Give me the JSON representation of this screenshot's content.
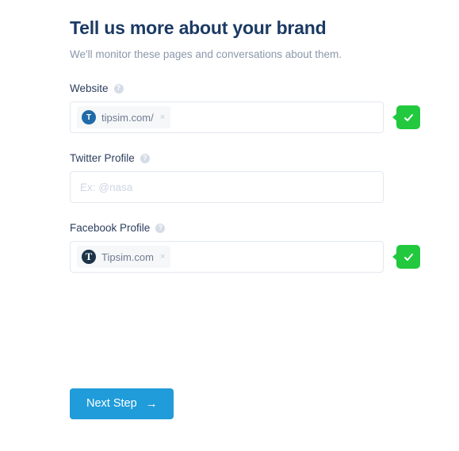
{
  "header": {
    "title": "Tell us more about your brand",
    "subtitle": "We'll monitor these pages and conversations about them."
  },
  "colors": {
    "heading": "#1b3a63",
    "subtitle": "#8a98ab",
    "label": "#2c3e5d",
    "input_border": "#e3e7ee",
    "chip_background": "#f6f7f9",
    "chip_text": "#6f7c8f",
    "placeholder": "#ccd6e4",
    "valid_green": "#22c93e",
    "primary_blue": "#209cda",
    "website_avatar": "#1f6aa8",
    "facebook_avatar": "#1c3348",
    "help_icon": "#d5dce6"
  },
  "fields": [
    {
      "id": "website",
      "label": "Website",
      "help_icon": "help-circle-icon",
      "placeholder": "",
      "chip": {
        "avatar_initial": "T",
        "avatar_style": "site",
        "label": "tipsim.com/",
        "remove_icon": "×"
      },
      "validated": true,
      "valid_icon": "check-icon"
    },
    {
      "id": "twitter",
      "label": "Twitter Profile",
      "help_icon": "help-circle-icon",
      "placeholder": "Ex: @nasa",
      "chip": null,
      "validated": false,
      "valid_icon": ""
    },
    {
      "id": "facebook",
      "label": "Facebook Profile",
      "help_icon": "help-circle-icon",
      "placeholder": "",
      "chip": {
        "avatar_initial": "T",
        "avatar_style": "fb",
        "label": "Tipsim.com",
        "remove_icon": "×"
      },
      "validated": true,
      "valid_icon": "check-icon"
    }
  ],
  "footer": {
    "next_step_label": "Next Step",
    "next_step_arrow": "→"
  },
  "help_glyph": "?"
}
